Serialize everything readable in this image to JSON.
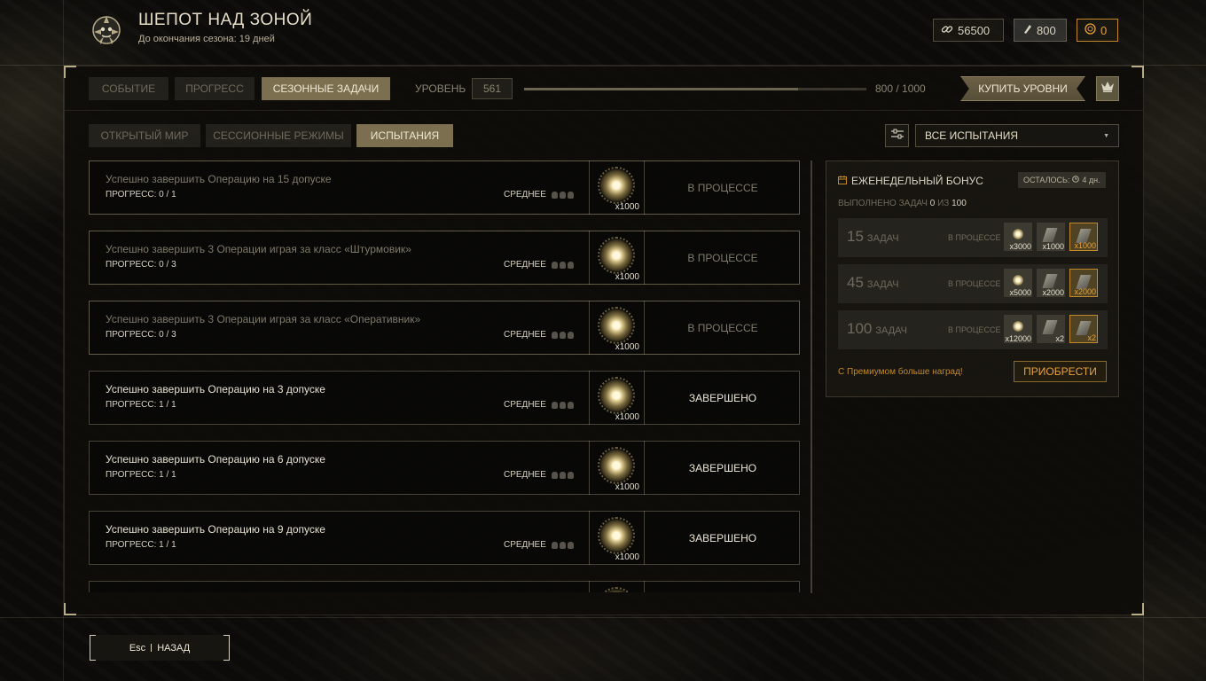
{
  "header": {
    "title": "ШЕПОТ НАД ЗОНОЙ",
    "subtitle": "До окончания сезона: 19 дней",
    "currencies": [
      {
        "icon": "chain-link-icon",
        "value": "56500"
      },
      {
        "icon": "ticket-icon",
        "value": "800"
      },
      {
        "icon": "gold-coin-icon",
        "value": "0"
      }
    ]
  },
  "top_tabs": [
    {
      "label": "СОБЫТИЕ",
      "active": false
    },
    {
      "label": "ПРОГРЕСС",
      "active": false
    },
    {
      "label": "СЕЗОННЫЕ ЗАДАЧИ",
      "active": true
    }
  ],
  "level": {
    "label": "УРОВЕНЬ",
    "value": "561",
    "progress_text": "800 / 1000",
    "progress_fraction": 0.8
  },
  "buy_levels_label": "КУПИТЬ УРОВНИ",
  "sub_tabs": [
    {
      "label": "ОТКРЫТЫЙ МИР",
      "active": false
    },
    {
      "label": "СЕССИОННЫЕ РЕЖИМЫ",
      "active": false
    },
    {
      "label": "ИСПЫТАНИЯ",
      "active": true
    }
  ],
  "filter": {
    "selected": "ВСЕ ИСПЫТАНИЯ"
  },
  "tasks": [
    {
      "title": "Успешно завершить Операцию на 15 допуске",
      "progress": "ПРОГРЕСС: 0 / 1",
      "difficulty": "СРЕДНЕЕ",
      "reward_qty": "x1000",
      "status": "В ПРОЦЕССЕ",
      "done": false
    },
    {
      "title": "Успешно завершить 3 Операции играя за класс «Штурмовик»",
      "progress": "ПРОГРЕСС: 0 / 3",
      "difficulty": "СРЕДНЕЕ",
      "reward_qty": "x1000",
      "status": "В ПРОЦЕССЕ",
      "done": false
    },
    {
      "title": "Успешно завершить 3 Операции играя за класс «Оперативник»",
      "progress": "ПРОГРЕСС: 0 / 3",
      "difficulty": "СРЕДНЕЕ",
      "reward_qty": "x1000",
      "status": "В ПРОЦЕССЕ",
      "done": false
    },
    {
      "title": "Успешно завершить Операцию на 3 допуске",
      "progress": "ПРОГРЕСС: 1 / 1",
      "difficulty": "СРЕДНЕЕ",
      "reward_qty": "x1000",
      "status": "ЗАВЕРШЕНО",
      "done": true
    },
    {
      "title": "Успешно завершить Операцию на 6 допуске",
      "progress": "ПРОГРЕСС: 1 / 1",
      "difficulty": "СРЕДНЕЕ",
      "reward_qty": "x1000",
      "status": "ЗАВЕРШЕНО",
      "done": true
    },
    {
      "title": "Успешно завершить Операцию на 9 допуске",
      "progress": "ПРОГРЕСС: 1 / 1",
      "difficulty": "СРЕДНЕЕ",
      "reward_qty": "x1000",
      "status": "ЗАВЕРШЕНО",
      "done": true
    }
  ],
  "weekly_bonus": {
    "title": "ЕЖЕНЕДЕЛЬНЫЙ БОНУС",
    "remaining_label": "ОСТАЛОСЬ:",
    "remaining_value": "4 дн.",
    "done_prefix": "ВЫПОЛНЕНО ЗАДАЧ",
    "done_value": "0",
    "done_of": "ИЗ",
    "done_total": "100",
    "rows": [
      {
        "count": "15",
        "label": "ЗАДАЧ",
        "status": "В ПРОЦЕССЕ",
        "rewards": [
          "x3000",
          "x1000",
          "x1000"
        ]
      },
      {
        "count": "45",
        "label": "ЗАДАЧ",
        "status": "В ПРОЦЕССЕ",
        "rewards": [
          "x5000",
          "x2000",
          "x2000"
        ]
      },
      {
        "count": "100",
        "label": "ЗАДАЧ",
        "status": "В ПРОЦЕССЕ",
        "rewards": [
          "x12000",
          "x2",
          "x2"
        ]
      }
    ],
    "premium_text": "С Премиумом больше наград!",
    "buy_label": "ПРИОБРЕСТИ"
  },
  "back": {
    "key": "Esc",
    "label": "НАЗАД"
  }
}
